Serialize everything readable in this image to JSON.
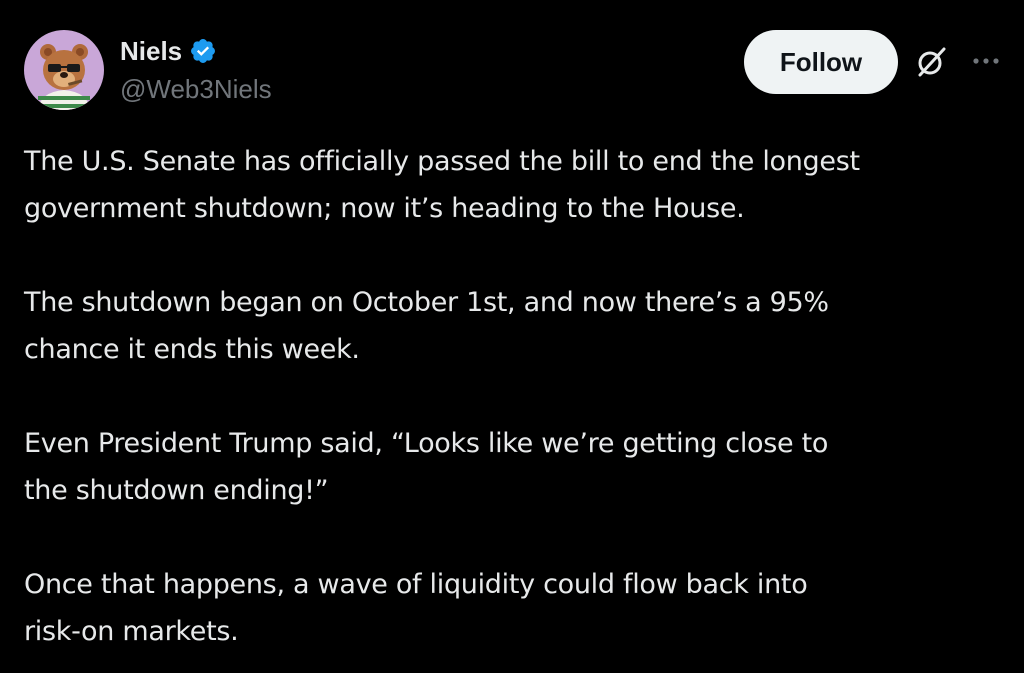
{
  "author": {
    "display_name": "Niels",
    "handle": "@Web3Niels",
    "verified_icon": "verified-badge-icon",
    "avatar_icon": "bear-avatar"
  },
  "actions": {
    "follow_label": "Follow",
    "grok_icon": "grok-slash-icon",
    "more_icon": "more-horizontal-icon"
  },
  "tweet": {
    "paragraphs": [
      "The U.S. Senate has officially passed the bill to end the longest\ngovernment shutdown; now it’s heading to the House.",
      "The shutdown began on October 1st, and now there’s a 95%\nchance it ends this week.",
      "Even President Trump said, “Looks like we’re getting close to\nthe shutdown ending!”",
      "Once that happens, a wave of liquidity could flow back into\nrisk-on markets."
    ]
  },
  "colors": {
    "background": "#000000",
    "text_primary": "#e7e9ea",
    "text_secondary": "#71767b",
    "verified_blue": "#1d9bf0",
    "follow_bg": "#eff3f4"
  }
}
